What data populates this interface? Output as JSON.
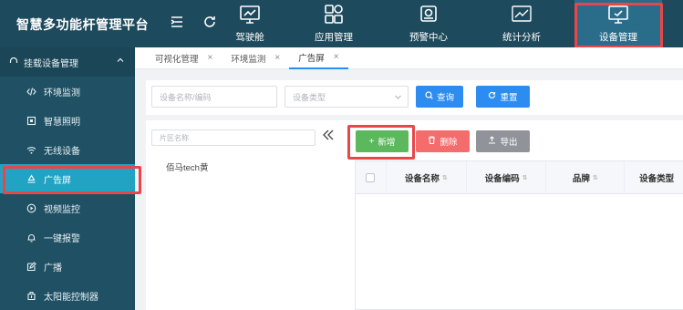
{
  "header": {
    "brand": "智慧多功能杆管理平台",
    "nav": [
      {
        "label": "驾驶舱",
        "icon": "dashboard-icon"
      },
      {
        "label": "应用管理",
        "icon": "apps-grid-icon"
      },
      {
        "label": "预警中心",
        "icon": "alarm-icon"
      },
      {
        "label": "统计分析",
        "icon": "line-chart-icon"
      },
      {
        "label": "设备管理",
        "icon": "monitor-icon",
        "active": true
      }
    ]
  },
  "sidebar": {
    "group": "挂载设备管理",
    "items": [
      {
        "label": "环境监测",
        "icon": "code-icon"
      },
      {
        "label": "智慧照明",
        "icon": "lamp-icon"
      },
      {
        "label": "无线设备",
        "icon": "wifi-icon"
      },
      {
        "label": "广告屏",
        "icon": "billboard-icon",
        "active": true
      },
      {
        "label": "视频监控",
        "icon": "video-icon"
      },
      {
        "label": "一键报警",
        "icon": "alarm-bell-icon"
      },
      {
        "label": "广播",
        "icon": "edit-icon"
      },
      {
        "label": "太阳能控制器",
        "icon": "solar-icon"
      }
    ]
  },
  "tabs": [
    {
      "label": "可视化管理"
    },
    {
      "label": "环境监测"
    },
    {
      "label": "广告屏",
      "active": true
    }
  ],
  "filters": {
    "name_placeholder": "设备名称/编码",
    "type_placeholder": "设备类型",
    "search_label": "查询",
    "reset_label": "重置"
  },
  "tree": {
    "search_placeholder": "片区名称",
    "nodes": [
      "佰马tech黄"
    ]
  },
  "toolbar": {
    "add_label": "新增",
    "delete_label": "删除",
    "export_label": "导出"
  },
  "table": {
    "columns": [
      "设备名称",
      "设备编码",
      "品牌",
      "设备类型"
    ]
  },
  "colors": {
    "header_bg": "#1d4a5c",
    "sidebar_bg": "#1f5064",
    "active_side": "#21a3c4",
    "primary": "#2d8cf0",
    "highlight": "#e8474a"
  }
}
